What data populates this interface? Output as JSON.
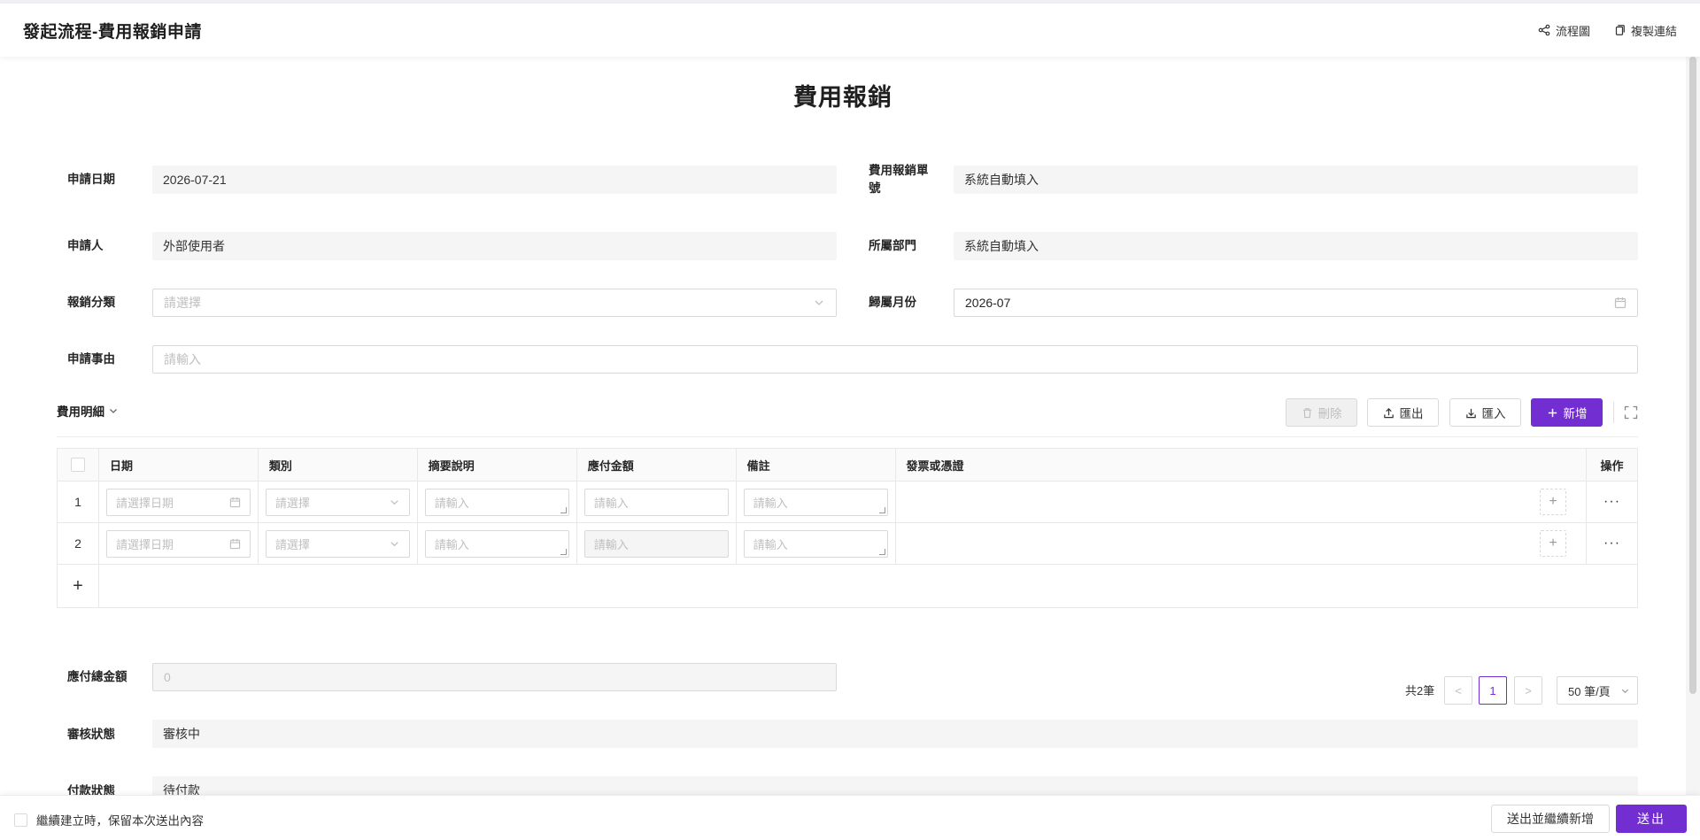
{
  "header": {
    "title": "發起流程-費用報銷申請",
    "flowchart_label": "流程圖",
    "copy_link_label": "複製連結"
  },
  "form": {
    "title": "費用報銷",
    "apply_date": {
      "label": "申請日期",
      "value": "2026-07-21"
    },
    "claim_no": {
      "label": "費用報銷單號",
      "value": "系統自動填入"
    },
    "applicant": {
      "label": "申請人",
      "value": "外部使用者"
    },
    "department": {
      "label": "所屬部門",
      "value": "系統自動填入"
    },
    "category": {
      "label": "報銷分類",
      "placeholder": "請選擇"
    },
    "month": {
      "label": "歸屬月份",
      "value": "2026-07"
    },
    "reason": {
      "label": "申請事由",
      "placeholder": "請輸入"
    },
    "total": {
      "label": "應付總金額",
      "value": "0"
    },
    "review_status": {
      "label": "審核狀態",
      "value": "審核中"
    },
    "payment_status": {
      "label": "付款狀態",
      "value": "待付款"
    }
  },
  "details": {
    "title": "費用明細",
    "delete_label": "刪除",
    "export_label": "匯出",
    "import_label": "匯入",
    "add_label": "新增",
    "columns": [
      "日期",
      "類別",
      "摘要說明",
      "應付金額",
      "備註",
      "發票或憑證",
      "操作"
    ],
    "rows": [
      {
        "index": "1",
        "date_placeholder": "請選擇日期",
        "category_placeholder": "請選擇",
        "summary_placeholder": "請輸入",
        "amount_placeholder": "請輸入",
        "note_placeholder": "請輸入"
      },
      {
        "index": "2",
        "date_placeholder": "請選擇日期",
        "category_placeholder": "請選擇",
        "summary_placeholder": "請輸入",
        "amount_placeholder": "請輸入",
        "note_placeholder": "請輸入"
      }
    ],
    "add_row_symbol": "+",
    "upload_symbol": "+",
    "more_symbol": "···"
  },
  "pagination": {
    "total_text": "共2筆",
    "prev": "<",
    "current": "1",
    "next": ">",
    "page_size": "50 筆/頁"
  },
  "footer": {
    "keep_content_label": "繼續建立時，保留本次送出內容",
    "submit_continue_label": "送出並繼續新增",
    "submit_label": "送出"
  },
  "colors": {
    "primary": "#722ed1",
    "field_bg": "#f5f5f5",
    "border": "#d9d9d9"
  },
  "icons": [
    "flowchart-icon",
    "copy-icon",
    "chevron-down-icon",
    "calendar-icon",
    "trash-icon",
    "upload-icon",
    "download-icon",
    "plus-icon",
    "fullscreen-icon"
  ]
}
